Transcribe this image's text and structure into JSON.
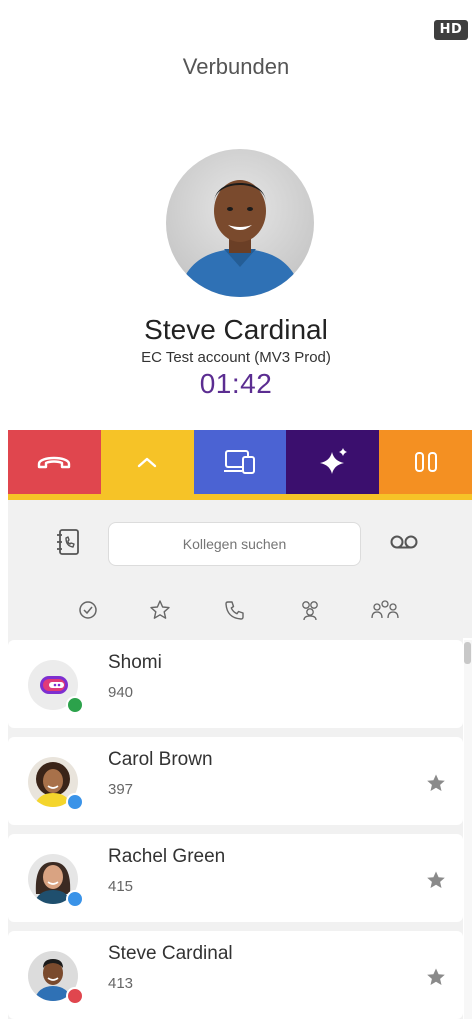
{
  "header": {
    "hd_badge": "HD",
    "status": "Verbunden"
  },
  "caller": {
    "name": "Steve Cardinal",
    "account": "EC Test account (MV3 Prod)",
    "timer": "01:42"
  },
  "actions": [
    {
      "icon": "hangup-icon",
      "color": "#e0464e"
    },
    {
      "icon": "chevron-up-icon",
      "color": "#f6c327"
    },
    {
      "icon": "device-switch-icon",
      "color": "#4b63d3"
    },
    {
      "icon": "sparkle-icon",
      "color": "#3b0f6e"
    },
    {
      "icon": "pause-icon",
      "color": "#f49022"
    }
  ],
  "tools": {
    "search_placeholder": "Kollegen suchen",
    "filters": [
      "check-circle-icon",
      "star-outline-icon",
      "phone-icon",
      "group-icon",
      "groups-icon"
    ]
  },
  "contacts": [
    {
      "name": "Shomi",
      "ext": "940",
      "presence": "#2ca24b",
      "favorite": false
    },
    {
      "name": "Carol Brown",
      "ext": "397",
      "presence": "#3a93e8",
      "favorite": true
    },
    {
      "name": "Rachel Green",
      "ext": "415",
      "presence": "#3a93e8",
      "favorite": true
    },
    {
      "name": "Steve Cardinal",
      "ext": "413",
      "presence": "#e0464e",
      "favorite": true
    }
  ]
}
